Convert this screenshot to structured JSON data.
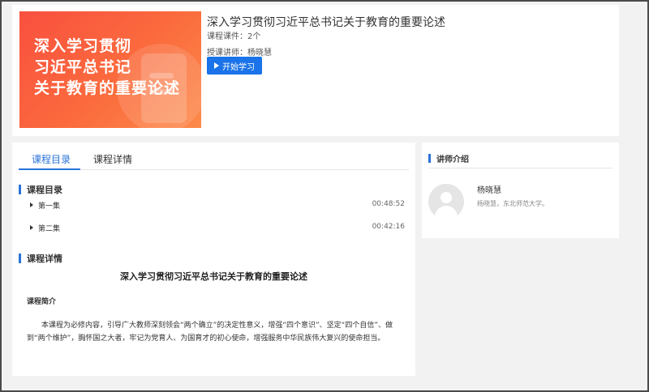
{
  "course": {
    "cover_lines": [
      "深入学习贯彻",
      "习近平总书记",
      "关于教育的重要论述"
    ],
    "title": "深入学习贯彻习近平总书记关于教育的重要论述",
    "lessons_count": "课程课件：2个",
    "instructor": "授课讲师：杨晓慧",
    "start_label": "开始学习"
  },
  "tabs": [
    {
      "label": "课程目录",
      "active": true
    },
    {
      "label": "课程详情",
      "active": false
    }
  ],
  "catalog": {
    "heading": "课程目录",
    "episodes": [
      {
        "name": "第一集",
        "duration": "00:48:52"
      },
      {
        "name": "第二集",
        "duration": "00:42:16"
      }
    ]
  },
  "details": {
    "heading": "课程详情",
    "title": "深入学习贯彻习近平总书记关于教育的重要论述",
    "intro_label": "课程简介",
    "intro_text": "本课程为必修内容，引导广大教师深刻领会“两个确立”的决定性意义，增强“四个意识”、坚定“四个自信”、做到“两个维护”，胸怀国之大者，牢记为党育人、为国育才的初心使命，增强服务中华民族伟大复兴的使命担当。"
  },
  "teacher": {
    "heading": "讲师介绍",
    "name": "杨晓慧",
    "desc": "杨晓慧，东北师范大学。"
  },
  "colors": {
    "accent": "#2a73d9",
    "button": "#1a73e8",
    "cover": "#f9503f"
  }
}
